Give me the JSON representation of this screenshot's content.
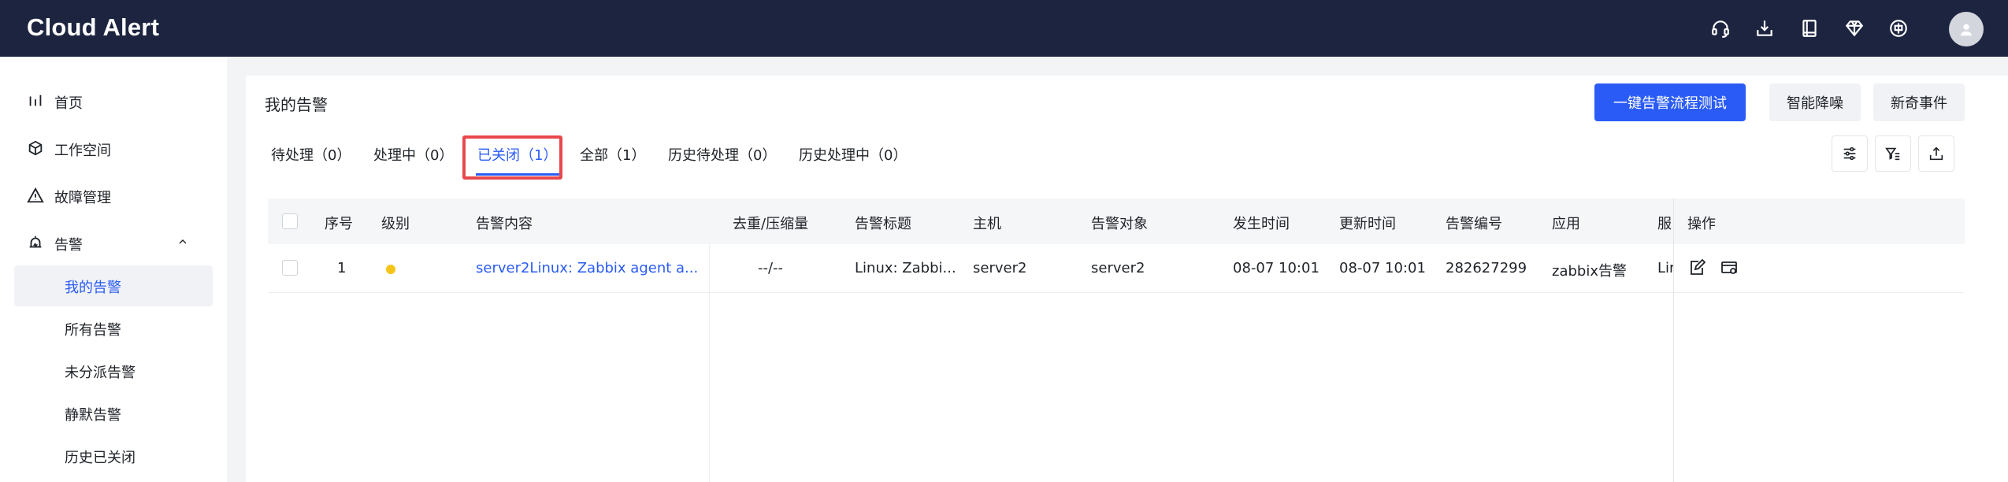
{
  "app": {
    "title": "Cloud Alert"
  },
  "header": {
    "icons": [
      "headset-icon",
      "download-icon",
      "book-icon",
      "diamond-icon",
      "language-icon"
    ],
    "avatar": "user-avatar-icon"
  },
  "sidebar": {
    "items": [
      {
        "label": "首页",
        "icon": "bar-chart-icon"
      },
      {
        "label": "工作空间",
        "icon": "cube-icon"
      },
      {
        "label": "故障管理",
        "icon": "warning-icon"
      },
      {
        "label": "告警",
        "icon": "alarm-icon"
      }
    ],
    "sub_items": [
      {
        "label": "我的告警",
        "active": true
      },
      {
        "label": "所有告警"
      },
      {
        "label": "未分派告警"
      },
      {
        "label": "静默告警"
      },
      {
        "label": "历史已关闭"
      }
    ]
  },
  "main": {
    "title": "我的告警",
    "buttons": {
      "primary": "一键告警流程测试",
      "denoise": "智能降噪",
      "novel": "新奇事件"
    },
    "tabs": [
      {
        "label": "待处理（0）"
      },
      {
        "label": "处理中（0）"
      },
      {
        "label": "已关闭（1）",
        "active": true
      },
      {
        "label": "全部（1）"
      },
      {
        "label": "历史待处理（0）"
      },
      {
        "label": "历史处理中（0）"
      }
    ],
    "tools": [
      "settings-sliders-icon",
      "filter-icon",
      "export-icon"
    ]
  },
  "table": {
    "columns": [
      "序号",
      "级别",
      "告警内容",
      "去重/压缩量",
      "告警标题",
      "主机",
      "告警对象",
      "发生时间",
      "更新时间",
      "告警编号",
      "应用",
      "服",
      "操作"
    ],
    "rows": [
      {
        "index": "1",
        "level_color": "#f5c518",
        "content": "server2Linux: Zabbix agent a...",
        "dedup": "--/--",
        "title": "Linux: Zabbi...",
        "host": "server2",
        "target": "server2",
        "occurred": "08-07 10:01",
        "updated": "08-07 10:01",
        "alert_id": "282627299",
        "app": "zabbix告警",
        "service": "Lir"
      }
    ]
  },
  "colors": {
    "topbar": "#1c2440",
    "accent": "#2a5bf6",
    "highlight": "#e8484c",
    "warning": "#f5c518"
  }
}
